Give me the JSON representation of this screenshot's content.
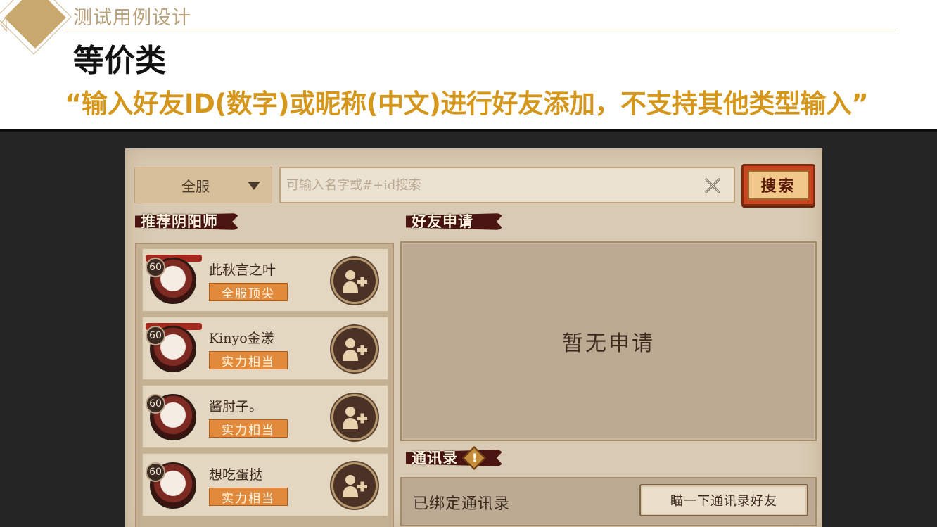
{
  "slide": {
    "section_label": "测试用例设计",
    "title": "等价类",
    "subtitle": "“输入好友ID(数字)或昵称(中文)进行好友添加，不支持其他类型输入”"
  },
  "app": {
    "server_select": {
      "value": "全服"
    },
    "search": {
      "placeholder": "可输入名字或#+id搜索",
      "value": "",
      "button_label": "搜索"
    },
    "recommend": {
      "title": "推荐阴阳师",
      "items": [
        {
          "level": "60",
          "name": "此秋言之叶",
          "tag": "全服顶尖"
        },
        {
          "level": "60",
          "name": "Kinyo金漾",
          "tag": "实力相当"
        },
        {
          "level": "60",
          "name": "酱肘子。",
          "tag": "实力相当"
        },
        {
          "level": "60",
          "name": "想吃蛋挞",
          "tag": "实力相当"
        }
      ]
    },
    "requests": {
      "title": "好友申请",
      "empty_text": "暂无申请"
    },
    "contacts": {
      "title": "通讯录",
      "status_text": "已绑定通讯录",
      "button_label": "瞄一下通讯录好友"
    }
  },
  "colors": {
    "accent": "#d4971b",
    "diamond": "#c9a86d",
    "panel_bg": "#d9cab3",
    "tag_orange": "#e18a3b"
  },
  "icons": [
    "chevron-down-icon",
    "clear-icon",
    "add-friend-icon",
    "warning-icon"
  ]
}
